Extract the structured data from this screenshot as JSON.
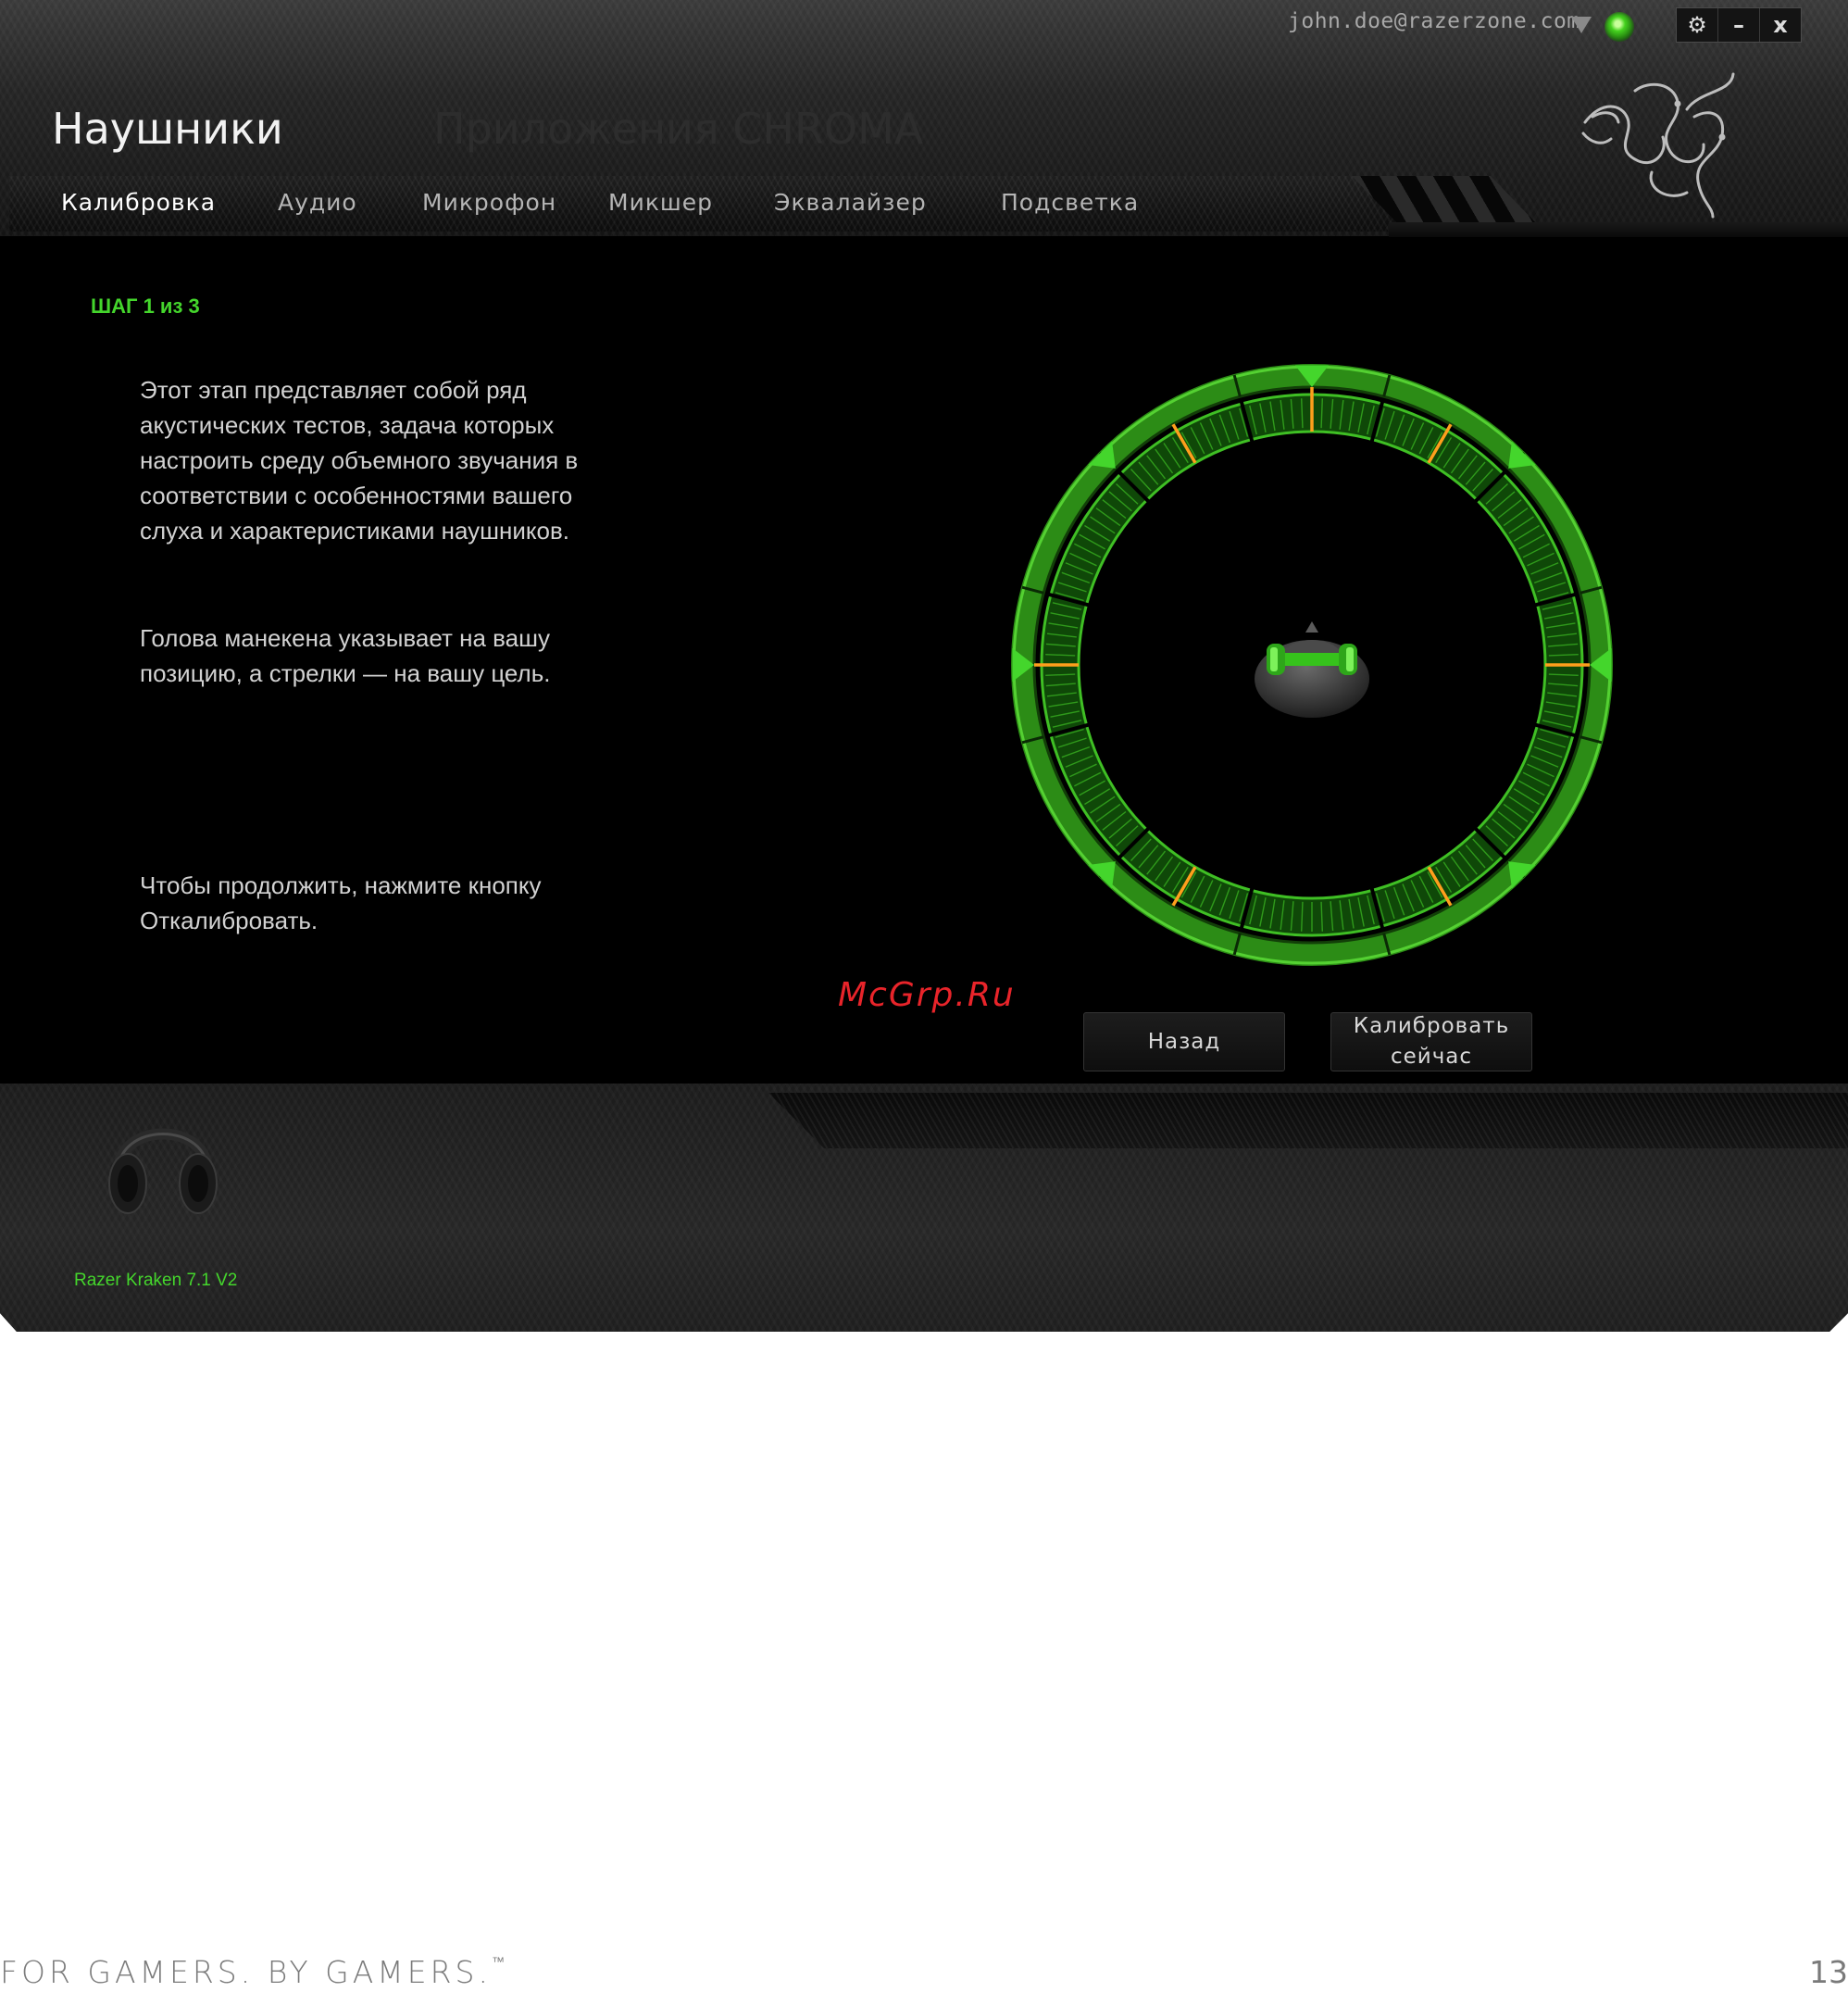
{
  "window": {
    "title": "Наушники",
    "subtitle": "Приложения CHROMA",
    "user_email": "john.doe@razerzone.com",
    "controls": {
      "settings_glyph": "⚙",
      "minimize_glyph": "–",
      "close_glyph": "x"
    }
  },
  "tabs": [
    {
      "label": "Калибровка",
      "active": true
    },
    {
      "label": "Аудио",
      "active": false
    },
    {
      "label": "Микрофон",
      "active": false
    },
    {
      "label": "Микшер",
      "active": false
    },
    {
      "label": "Эквалайзер",
      "active": false
    },
    {
      "label": "Подсветка",
      "active": false
    }
  ],
  "content": {
    "step": "ШАГ 1 из 3",
    "paragraph1": "Этот этап представляет собой ряд акустических тестов, задача которых настроить среду объемного звучания в соответствии с особенностями вашего слуха и характеристиками наушников.",
    "paragraph2": "Голова манекена указывает на вашу позицию, а стрелки — на вашу цель.",
    "paragraph3": "Чтобы продолжить, нажмите кнопку Откалибровать."
  },
  "buttons": {
    "back": "Назад",
    "calibrate": "Калибровать сейчас"
  },
  "footer": {
    "device_name": "Razer Kraken 7.1 V2"
  },
  "watermark": "McGrp.Ru",
  "page": {
    "tagline": "FOR GAMERS. BY GAMERS.",
    "trademark": "™",
    "number": "13"
  },
  "colors": {
    "accent": "#44d62c",
    "marker": "#ff9f1c",
    "watermark": "#e8242a"
  }
}
